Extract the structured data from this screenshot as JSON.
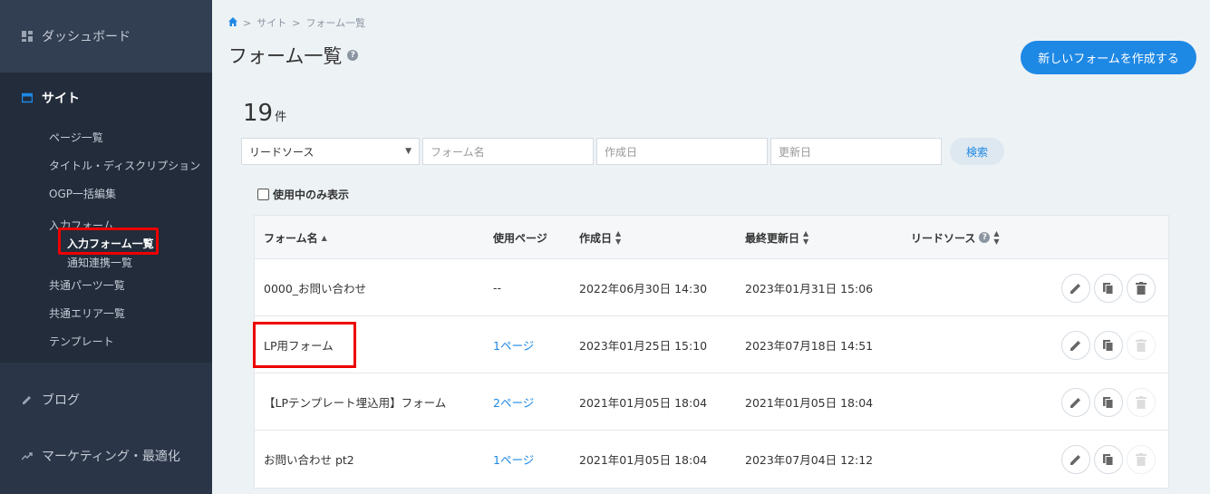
{
  "sidebar": {
    "dashboard": "ダッシュボード",
    "site": "サイト",
    "links": {
      "pages": "ページ一覧",
      "title_desc": "タイトル・ディスクリプション",
      "ogp": "OGP一括編集",
      "input_form": "入力フォーム",
      "form_list": "入力フォーム一覧",
      "notify": "通知連携一覧",
      "parts": "共通パーツ一覧",
      "area": "共通エリア一覧",
      "template": "テンプレート"
    },
    "blog": "ブログ",
    "marketing": "マーケティング・最適化"
  },
  "breadcrumb": {
    "site": "サイト",
    "current": "フォーム一覧",
    "sep": ">"
  },
  "page": {
    "title": "フォーム一覧",
    "new_button": "新しいフォームを作成する",
    "count": "19",
    "count_unit": "件"
  },
  "filters": {
    "lead_source": "リードソース",
    "form_name_ph": "フォーム名",
    "created_ph": "作成日",
    "updated_ph": "更新日",
    "search": "検索",
    "only_in_use": "使用中のみ表示"
  },
  "table": {
    "headers": {
      "name": "フォーム名",
      "pages": "使用ページ",
      "created": "作成日",
      "updated": "最終更新日",
      "lead": "リードソース"
    },
    "rows": [
      {
        "name": "0000_お問い合わせ",
        "pages": "--",
        "created": "2022年06月30日 14:30",
        "updated": "2023年01月31日 15:06"
      },
      {
        "name": "LP用フォーム",
        "pages": "1ページ",
        "created": "2023年01月25日 15:10",
        "updated": "2023年07月18日 14:51"
      },
      {
        "name": "【LPテンプレート埋込用】フォーム",
        "pages": "2ページ",
        "created": "2021年01月05日 18:04",
        "updated": "2021年01月05日 18:04"
      },
      {
        "name": "お問い合わせ pt2",
        "pages": "1ページ",
        "created": "2021年01月05日 18:04",
        "updated": "2023年07月04日 12:12"
      }
    ]
  },
  "colors": {
    "accent": "#1e88e5",
    "sidebar": "#2a3547",
    "highlight": "#ee0000"
  }
}
